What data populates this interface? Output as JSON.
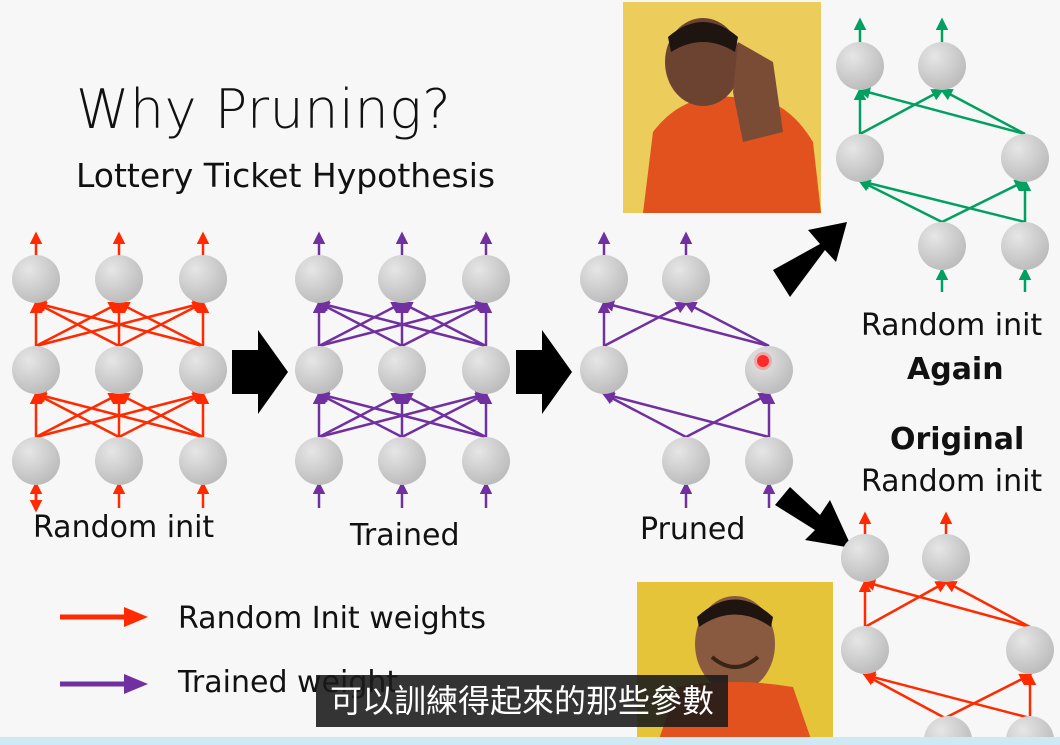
{
  "slide": {
    "title": "Why Pruning?",
    "subtitle": "Lottery Ticket Hypothesis"
  },
  "networks": {
    "random_init": "Random init",
    "trained": "Trained",
    "pruned": "Pruned",
    "random_init_again_1": "Random init",
    "random_init_again_2": "Again",
    "original_1": "Original",
    "original_2": "Random init"
  },
  "legend": {
    "random_weights": "Random Init weights",
    "trained_weight": "Trained weight"
  },
  "subtitle_caption": "可以訓練得起來的那些參數",
  "colors": {
    "random": "#ff2a00",
    "trained": "#7030a0",
    "again": "#00a060",
    "node": "#c8c8c8",
    "arrow": "#000000"
  }
}
